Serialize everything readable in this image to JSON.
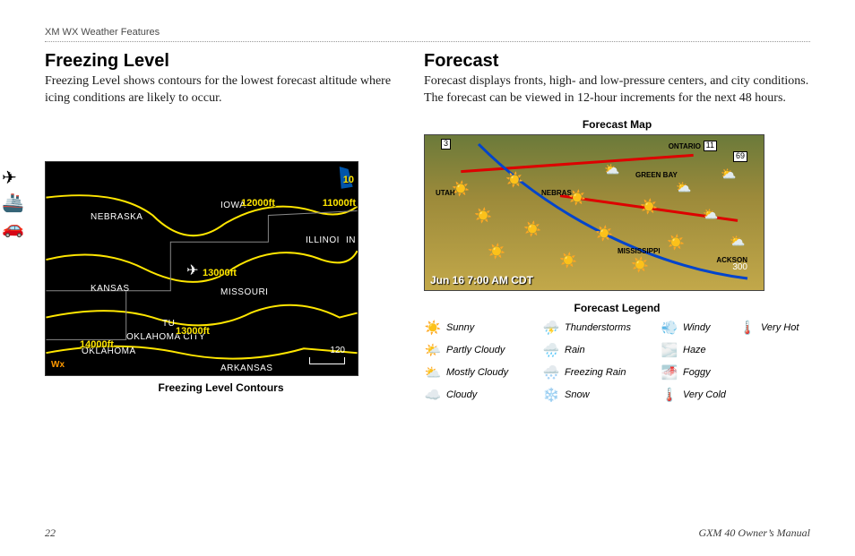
{
  "header": "XM WX Weather Features",
  "left": {
    "title": "Freezing Level",
    "body": "Freezing Level shows contours for the lowest forecast altitude where icing conditions are likely to occur.",
    "map": {
      "caption": "Freezing Level Contours",
      "states": {
        "nebraska": "NEBRASKA",
        "iowa": "IOWA",
        "kansas": "KANSAS",
        "missouri": "MISSOURI",
        "illinois": "ILLINOI",
        "in": "IN",
        "tu": "TU",
        "okc": "OKLAHOMA CITY",
        "oklahoma": "OKLAHOMA",
        "arkansas": "ARKANSAS"
      },
      "contours": {
        "c10": "10",
        "c11000": "11000ft",
        "c12000": "12000ft",
        "c13000a": "13000ft",
        "c13000b": "13000ft",
        "c14000": "14000ft"
      },
      "scale": "120",
      "wx": "Wx"
    }
  },
  "right": {
    "title": "Forecast",
    "body": "Forecast displays fronts, high- and low-pressure centers, and city conditions. The forecast can be viewed in 12-hour increments for the next 48 hours.",
    "map_caption": "Forecast Map",
    "map": {
      "time": "Jun 16 7:00 AM CDT",
      "states": {
        "utah": "UTAH",
        "nebraska": "NEBRAS",
        "greenbay": "GREEN BAY",
        "mississippi": "MISSISSIPPI",
        "jackson": "ACKSON",
        "ontario": "ONTARIO"
      },
      "roads": {
        "r3": "3",
        "r11": "11",
        "r69": "69"
      },
      "scale": "300"
    },
    "legend_caption": "Forecast Legend",
    "legend": {
      "sunny": "Sunny",
      "thunderstorms": "Thunderstorms",
      "windy": "Windy",
      "veryhot": "Very Hot",
      "partlycloudy": "Partly Cloudy",
      "rain": "Rain",
      "haze": "Haze",
      "mostlycloudy": "Mostly Cloudy",
      "freezingrain": "Freezing Rain",
      "foggy": "Foggy",
      "cloudy": "Cloudy",
      "snow": "Snow",
      "verycold": "Very Cold"
    }
  },
  "footer": {
    "page": "22",
    "manual": "GXM 40 Owner’s Manual"
  },
  "sidebar": {
    "plane": "plane-icon",
    "boat": "boat-icon",
    "car": "car-icon"
  }
}
